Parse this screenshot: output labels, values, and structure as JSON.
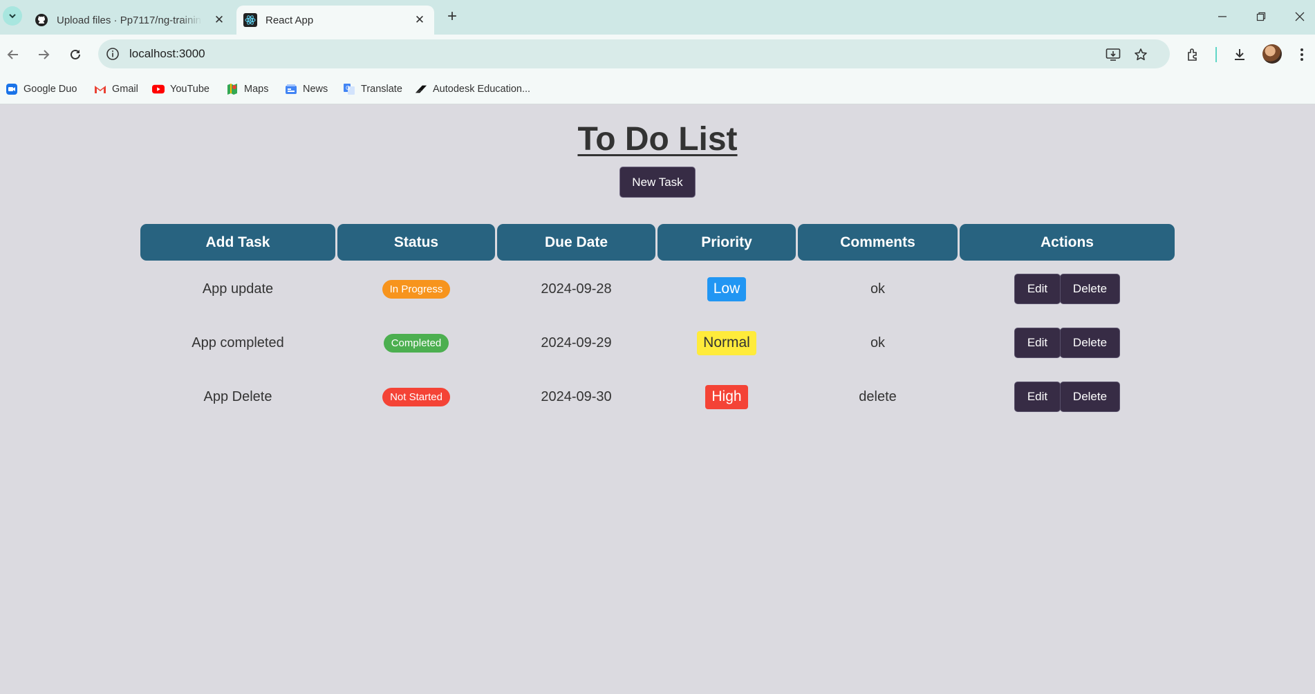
{
  "browser": {
    "tabs": [
      {
        "title": "Upload files · Pp7117/ng-training",
        "icon": "github-icon"
      },
      {
        "title": "React App",
        "icon": "react-icon"
      }
    ],
    "url": "localhost:3000",
    "bookmarks": [
      {
        "label": "Google Duo",
        "icon": "duo-icon"
      },
      {
        "label": "Gmail",
        "icon": "gmail-icon"
      },
      {
        "label": "YouTube",
        "icon": "youtube-icon"
      },
      {
        "label": "Maps",
        "icon": "maps-icon"
      },
      {
        "label": "News",
        "icon": "news-icon"
      },
      {
        "label": "Translate",
        "icon": "translate-icon"
      },
      {
        "label": "Autodesk Education...",
        "icon": "autodesk-icon"
      }
    ]
  },
  "page": {
    "title": "To Do List",
    "new_task_label": "New Task",
    "columns": [
      "Add Task",
      "Status",
      "Due Date",
      "Priority",
      "Comments",
      "Actions"
    ],
    "rows": [
      {
        "task": "App update",
        "status": "In Progress",
        "due": "2024-09-28",
        "priority": "Low",
        "comment": "ok"
      },
      {
        "task": "App completed",
        "status": "Completed",
        "due": "2024-09-29",
        "priority": "Normal",
        "comment": "ok"
      },
      {
        "task": "App Delete",
        "status": "Not Started",
        "due": "2024-09-30",
        "priority": "High",
        "comment": "delete"
      }
    ],
    "edit_label": "Edit",
    "delete_label": "Delete"
  },
  "colors": {
    "header": "#286380",
    "button": "#372c45",
    "status_in_progress": "#f7941d",
    "status_completed": "#4caf50",
    "status_not_started": "#f44336",
    "priority_low": "#2196f3",
    "priority_normal": "#ffeb3b",
    "priority_high": "#f44336"
  }
}
